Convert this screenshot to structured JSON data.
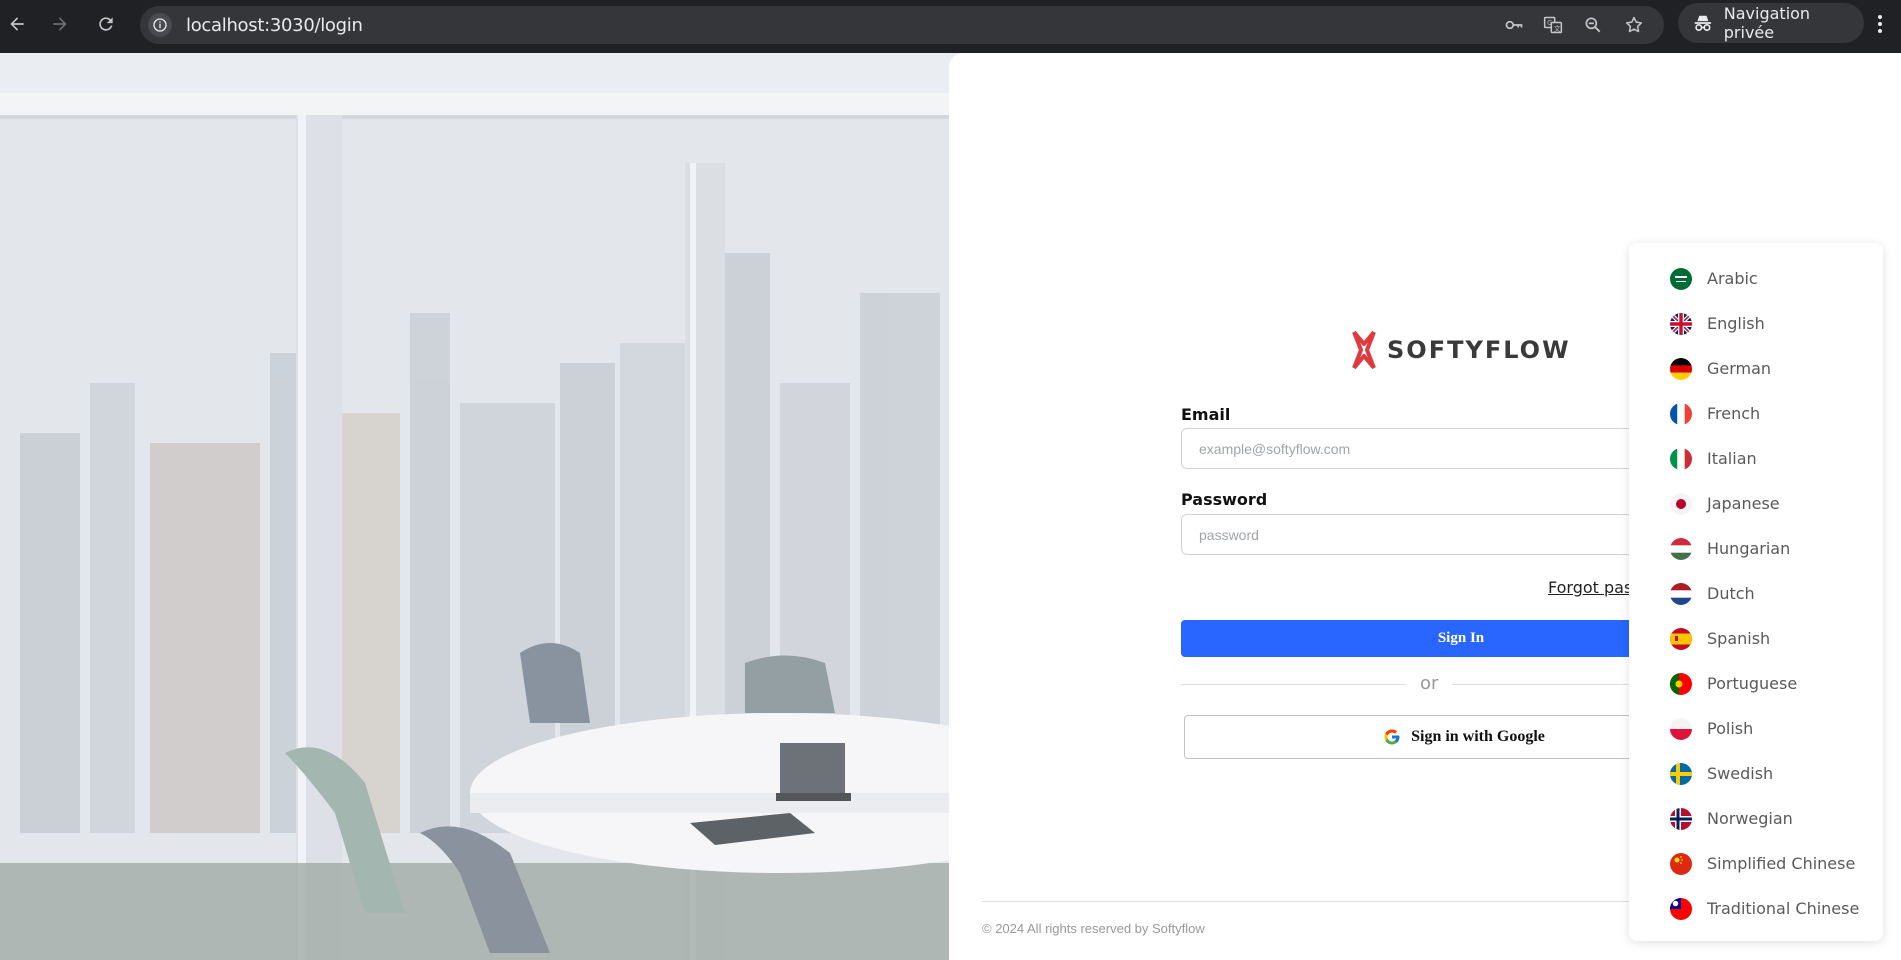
{
  "browser": {
    "url": "localhost:3030/login",
    "private_label": "Navigation privée"
  },
  "login": {
    "brand": "SOFTYFLOW",
    "email_label": "Email",
    "email_placeholder": "example@softyflow.com",
    "password_label": "Password",
    "password_placeholder": "password",
    "forgot_label": "Forgot pass",
    "signin_label": "Sign In",
    "or_label": "or",
    "google_label": "Sign in with Google",
    "accent_color": "#2866ff"
  },
  "footer": {
    "copyright": "© 2024 All rights reserved by Softyflow"
  },
  "languages": [
    {
      "label": "Arabic",
      "flag": "sa"
    },
    {
      "label": "English",
      "flag": "gb"
    },
    {
      "label": "German",
      "flag": "de"
    },
    {
      "label": "French",
      "flag": "fr"
    },
    {
      "label": "Italian",
      "flag": "it"
    },
    {
      "label": "Japanese",
      "flag": "jp"
    },
    {
      "label": "Hungarian",
      "flag": "hu"
    },
    {
      "label": "Dutch",
      "flag": "nl"
    },
    {
      "label": "Spanish",
      "flag": "es"
    },
    {
      "label": "Portuguese",
      "flag": "pt"
    },
    {
      "label": "Polish",
      "flag": "pl"
    },
    {
      "label": "Swedish",
      "flag": "se"
    },
    {
      "label": "Norwegian",
      "flag": "no"
    },
    {
      "label": "Simplified Chinese",
      "flag": "cn"
    },
    {
      "label": "Traditional Chinese",
      "flag": "tw"
    }
  ]
}
